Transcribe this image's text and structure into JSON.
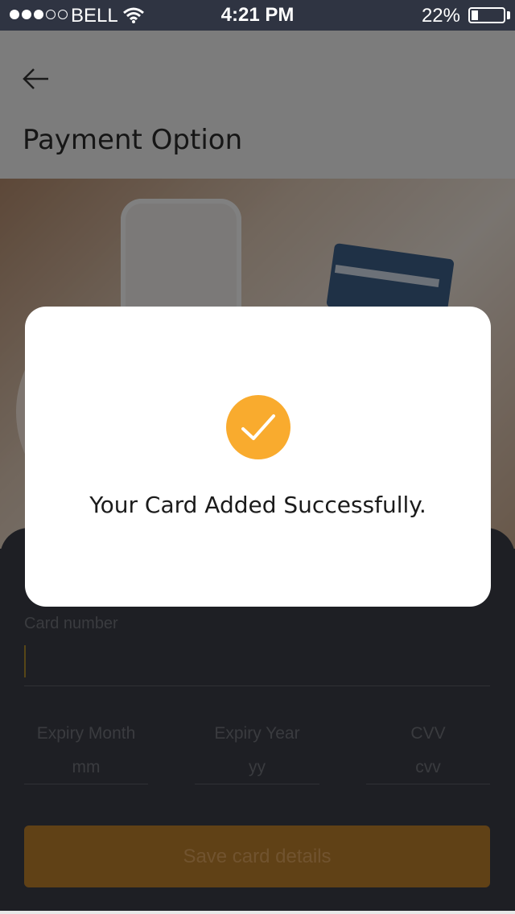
{
  "status_bar": {
    "carrier": "BELL",
    "time": "4:21 PM",
    "battery": "22%",
    "battery_level": 0.22,
    "signal_strength": 3,
    "signal_total": 5
  },
  "header": {
    "back_icon": "arrow-left-icon",
    "title": "Payment Option"
  },
  "form": {
    "card_number_label": "Card number",
    "card_number_value": "",
    "expiry_month_label": "Expiry Month",
    "expiry_month_placeholder": "mm",
    "expiry_year_label": "Expiry Year",
    "expiry_year_placeholder": "yy",
    "cvv_label": "CVV",
    "cvv_placeholder": "cvv",
    "save_label": "Save card details"
  },
  "dialog": {
    "icon": "checkmark-circle-icon",
    "message": "Your Card Added Successfully."
  },
  "colors": {
    "accent": "#f9ab2e",
    "status_bar": "#2f3442",
    "panel": "#3a3d45"
  }
}
